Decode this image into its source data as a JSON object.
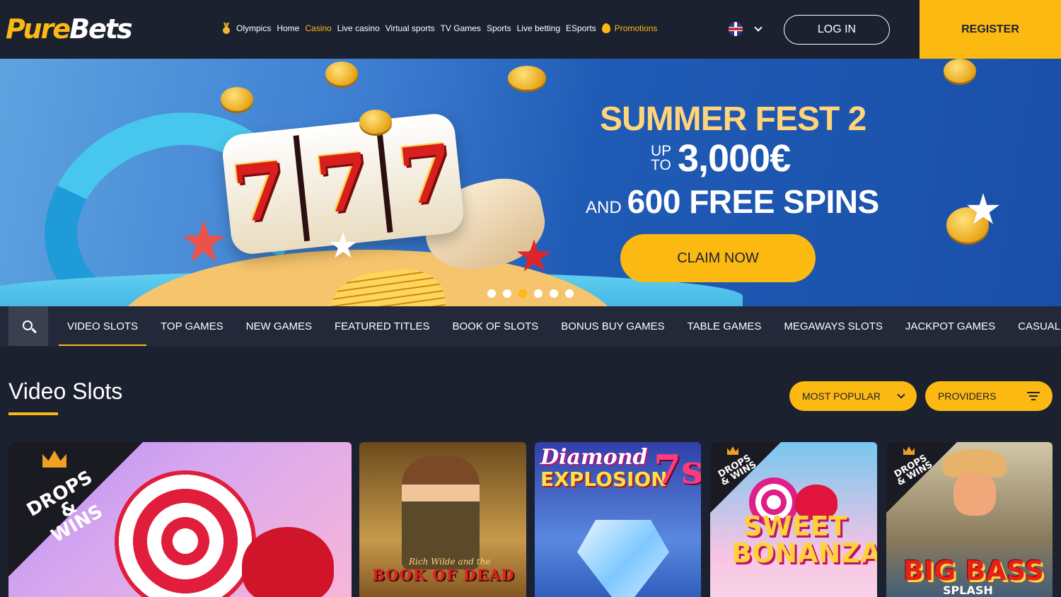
{
  "header": {
    "logo_part1": "Pure",
    "logo_part2": "Bets",
    "nav": [
      {
        "label": "Olympics",
        "icon": "medal-icon"
      },
      {
        "label": "Home"
      },
      {
        "label": "Casino",
        "active": true
      },
      {
        "label": "Live casino"
      },
      {
        "label": "Virtual sports"
      },
      {
        "label": "TV Games"
      },
      {
        "label": "Sports"
      },
      {
        "label": "Live betting"
      },
      {
        "label": "ESports"
      },
      {
        "label": "Promotions",
        "icon": "flame-icon",
        "highlight": true
      }
    ],
    "language_icon": "uk-flag-icon",
    "login_label": "LOG IN",
    "register_label": "REGISTER"
  },
  "banner": {
    "title": "SUMMER FEST 2",
    "up_to": "UP TO",
    "amount": "3,000€",
    "and": "AND",
    "spins": "600 FREE SPINS",
    "cta": "CLAIM NOW",
    "slide_count": 6,
    "active_slide": 3
  },
  "categories": {
    "search_icon": "search-icon",
    "tabs": [
      {
        "label": "VIDEO SLOTS",
        "active": true
      },
      {
        "label": "TOP GAMES"
      },
      {
        "label": "NEW GAMES"
      },
      {
        "label": "FEATURED TITLES"
      },
      {
        "label": "BOOK OF SLOTS"
      },
      {
        "label": "BONUS BUY GAMES"
      },
      {
        "label": "TABLE GAMES"
      },
      {
        "label": "MEGAWAYS SLOTS"
      },
      {
        "label": "JACKPOT GAMES"
      },
      {
        "label": "CASUAL GAMES"
      }
    ]
  },
  "section": {
    "title": "Video Slots",
    "sort_label": "MOST POPULAR",
    "providers_label": "PROVIDERS"
  },
  "games": {
    "g1": {
      "badge": "DROPS & WINS"
    },
    "g2": {
      "subtitle": "Rich Wilde and the",
      "title": "BOOK OF DEAD"
    },
    "g3": {
      "title": "Diamond",
      "title2": "EXPLOSION",
      "sevens": "7s"
    },
    "g4": {
      "badge": "DROPS & WINS",
      "title": "SWEET BONANZA"
    },
    "g5": {
      "badge": "DROPS & WINS",
      "title": "BIG BASS",
      "subtitle": "SPLASH"
    }
  },
  "colors": {
    "accent": "#fbb912",
    "background": "#1c2130",
    "tab_bar": "#232938"
  }
}
